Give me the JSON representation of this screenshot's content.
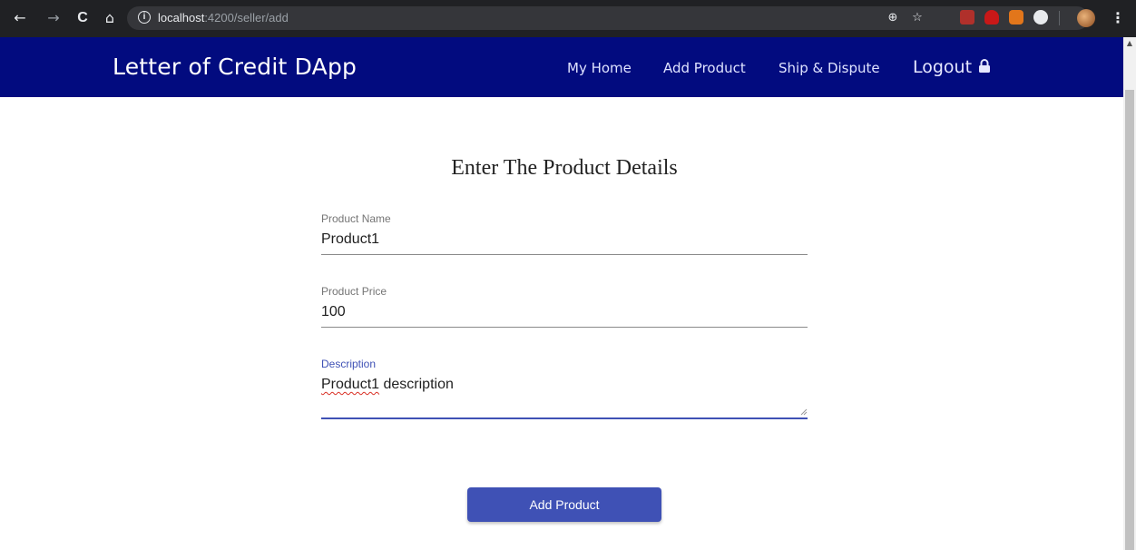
{
  "browser": {
    "url_host": "localhost",
    "url_path": ":4200/seller/add",
    "back_icon": "←",
    "forward_icon": "→",
    "reload_icon": "C",
    "home_icon": "⌂",
    "zoom_icon": "⊕",
    "star_icon": "☆",
    "menu_icon": "⋮"
  },
  "header": {
    "brand": "Letter of Credit DApp",
    "nav": {
      "home": "My Home",
      "add_product": "Add Product",
      "ship_dispute": "Ship & Dispute"
    },
    "logout": "Logout",
    "colors": {
      "bar": "#020b7f",
      "accent": "#3f51b5"
    }
  },
  "form": {
    "title": "Enter The Product Details",
    "name_label": "Product Name",
    "name_value": "Product1",
    "price_label": "Product Price",
    "price_value": "100",
    "description_label": "Description",
    "description_word1": "Product1",
    "description_rest": " description",
    "submit_label": "Add Product"
  }
}
